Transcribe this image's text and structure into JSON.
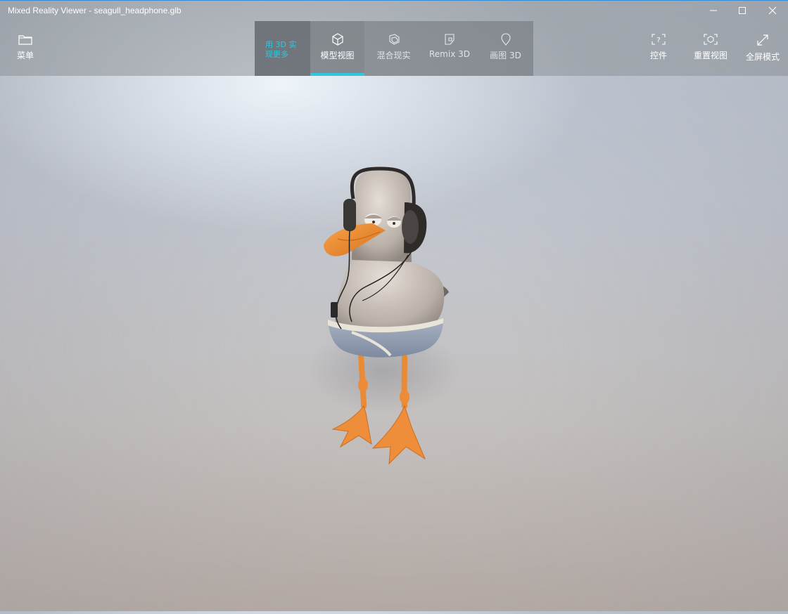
{
  "window": {
    "title": "Mixed Reality Viewer - seagull_headphone.glb",
    "accent_color": "#3b8ad0"
  },
  "toolbar_left": {
    "menu_label": "菜单",
    "menu_icon": "folder-icon"
  },
  "promo": {
    "text": "用 3D 实现更多",
    "color": "#2fc7e0"
  },
  "tabs": [
    {
      "label": "模型视图",
      "icon": "cube-icon",
      "active": true
    },
    {
      "label": "混合现实",
      "icon": "mixed-reality-icon",
      "active": false
    },
    {
      "label": "Remix 3D",
      "icon": "remix-icon",
      "active": false
    },
    {
      "label": "画图 3D",
      "icon": "paint3d-icon",
      "active": false
    }
  ],
  "toolbar_right": {
    "controls_label": "控件",
    "reset_label": "重置视图",
    "fullscreen_label": "全屏模式"
  },
  "model": {
    "name": "seagull-with-headphones"
  }
}
